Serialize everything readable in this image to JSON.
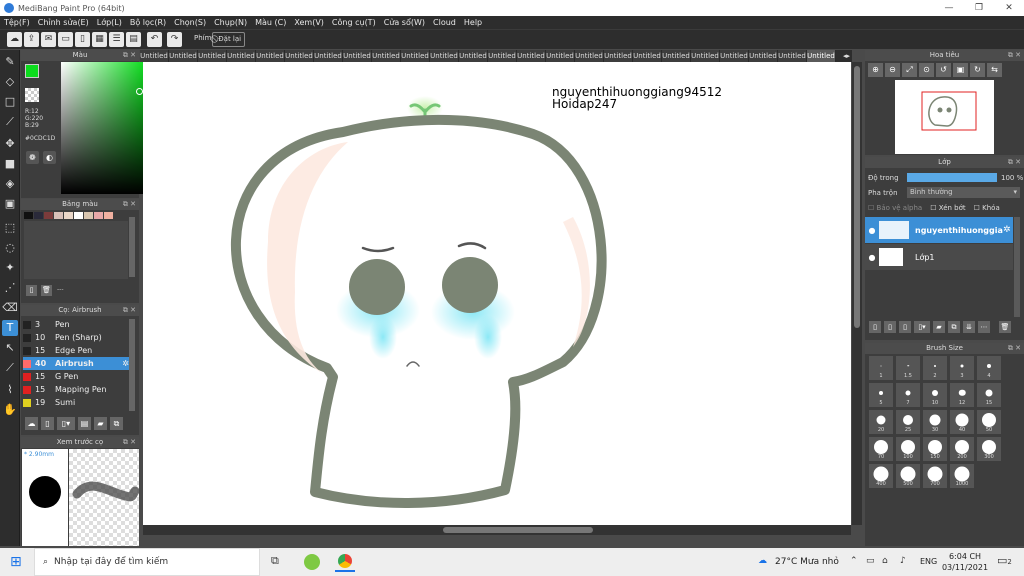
{
  "app": {
    "title": "MediBang Paint Pro (64bit)"
  },
  "menu": [
    "Tệp(F)",
    "Chỉnh sửa(E)",
    "Lớp(L)",
    "Bộ lọc(R)",
    "Chọn(S)",
    "Chụp(N)",
    "Màu (C)",
    "Xem(V)",
    "Công cụ(T)",
    "Cửa sổ(W)",
    "Cloud",
    "Help"
  ],
  "toolbar": {
    "shortcut_label": "Phím",
    "reset_label": "Đặt lại"
  },
  "color_panel": {
    "title": "Màu",
    "r": "R:12",
    "g": "G:220",
    "b": "B:29",
    "hex": "#0CDC1D",
    "fg_color": "#0cdc1d"
  },
  "palette_panel": {
    "title": "Bảng màu",
    "swatches": [
      "#111111",
      "#2a2a3a",
      "#7b3b3b",
      "#d8c0b8",
      "#ead7c8",
      "#ffffff",
      "#d9c6b0",
      "#e8a8a8",
      "#f0b0a0"
    ],
    "dash": "---"
  },
  "brush_panel": {
    "title": "Cọ: Airbrush",
    "items": [
      {
        "color": "#222222",
        "size": "3",
        "name": "Pen"
      },
      {
        "color": "#222222",
        "size": "10",
        "name": "Pen (Sharp)"
      },
      {
        "color": "#222222",
        "size": "15",
        "name": "Edge Pen"
      },
      {
        "color": "#ff6b6b",
        "size": "40",
        "name": "Airbrush"
      },
      {
        "color": "#e02020",
        "size": "15",
        "name": "G Pen"
      },
      {
        "color": "#e02020",
        "size": "15",
        "name": "Mapping Pen"
      },
      {
        "color": "#e0d020",
        "size": "19",
        "name": "Sumi"
      }
    ]
  },
  "preview_panel": {
    "title": "Xem trước cọ",
    "size": "2.90mm"
  },
  "tabs": [
    "Untitled",
    "Untitled",
    "Untitled",
    "Untitled",
    "Untitled",
    "Untitled",
    "Untitled",
    "Untitled",
    "Untitled",
    "Untitled",
    "Untitled",
    "Untitled",
    "Untitled",
    "Untitled",
    "Untitled",
    "Untitled",
    "Untitled",
    "Untitled",
    "Untitled",
    "Untitled",
    "Untitled",
    "Untitled",
    "Untitled",
    "Untitled"
  ],
  "canvas": {
    "text_line1": "nguyenthihuonggiang94512",
    "text_line2": "Hoidap247"
  },
  "navigator": {
    "title": "Hoa tiêu"
  },
  "layer_panel": {
    "title": "Lớp",
    "opacity_label": "Độ trong",
    "opacity_value": "100 %",
    "blend_label": "Pha trộn",
    "blend_value": "Bình thường",
    "protect_alpha": "Bảo vệ alpha",
    "clipping": "Xén bớt",
    "lock": "Khóa",
    "layers": [
      {
        "name": "nguyenthihuonggiang",
        "selected": true
      },
      {
        "name": "Lớp1",
        "selected": false
      }
    ]
  },
  "brush_size": {
    "title": "Brush Size",
    "sizes": [
      "1",
      "1.5",
      "2",
      "3",
      "4",
      "5",
      "7",
      "10",
      "12",
      "15",
      "20",
      "25",
      "30",
      "40",
      "50",
      "70",
      "100",
      "150",
      "200",
      "300",
      "400",
      "500",
      "700",
      "1000"
    ]
  },
  "taskbar": {
    "search_placeholder": "Nhập tại đây để tìm kiếm",
    "weather": "27°C  Mưa nhỏ",
    "lang": "ENG",
    "time": "6:04 CH",
    "date": "03/11/2021",
    "notif": "2"
  }
}
